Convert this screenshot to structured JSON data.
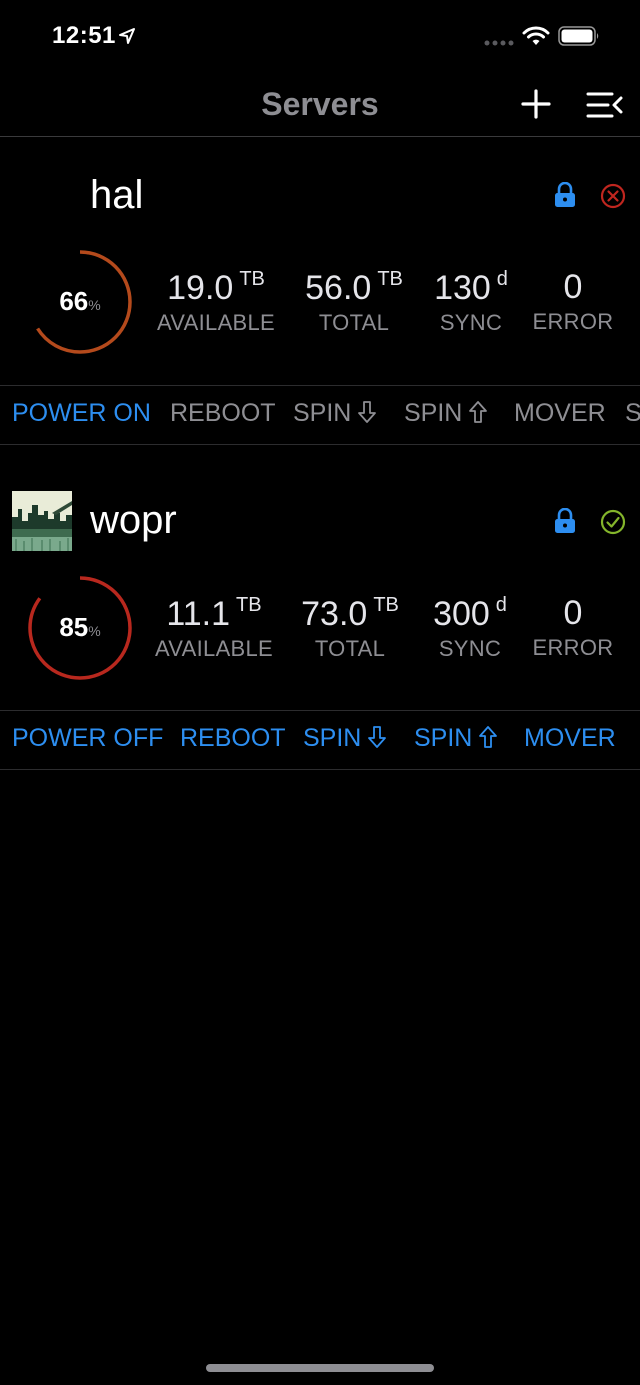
{
  "status_bar": {
    "time": "12:51",
    "icons": [
      "location-arrow-icon",
      "signal-dots-icon",
      "wifi-icon",
      "battery-icon"
    ]
  },
  "nav": {
    "title": "Servers",
    "icons": [
      "add-icon",
      "menu-icon"
    ]
  },
  "colors": {
    "accent": "#2d8ef0",
    "muted": "#8e8e93",
    "error": "#c0261f",
    "ok": "#84b52b",
    "gauge_hal": "#b44a1c",
    "gauge_wopr": "#b8281e"
  },
  "servers": [
    {
      "name": "hal",
      "usage_percent": 66,
      "usage_value": "66",
      "percent_sign": "%",
      "stats": [
        {
          "value": "19.0",
          "unit": "TB",
          "label": "AVAILABLE"
        },
        {
          "value": "56.0",
          "unit": "TB",
          "label": "TOTAL"
        },
        {
          "value": "130",
          "unit": "d",
          "label": "SYNC"
        },
        {
          "value": "0",
          "unit": "",
          "label": "ERROR"
        }
      ],
      "status": "error",
      "actions": [
        "POWER ON",
        "REBOOT",
        "SPIN",
        "SPIN",
        "MOVER",
        "S"
      ]
    },
    {
      "name": "wopr",
      "usage_percent": 85,
      "usage_value": "85",
      "percent_sign": "%",
      "stats": [
        {
          "value": "11.1",
          "unit": "TB",
          "label": "AVAILABLE"
        },
        {
          "value": "73.0",
          "unit": "TB",
          "label": "TOTAL"
        },
        {
          "value": "300",
          "unit": "d",
          "label": "SYNC"
        },
        {
          "value": "0",
          "unit": "",
          "label": "ERROR"
        }
      ],
      "status": "ok",
      "actions": [
        "POWER OFF",
        "REBOOT",
        "SPIN",
        "SPIN",
        "MOVER"
      ]
    }
  ]
}
